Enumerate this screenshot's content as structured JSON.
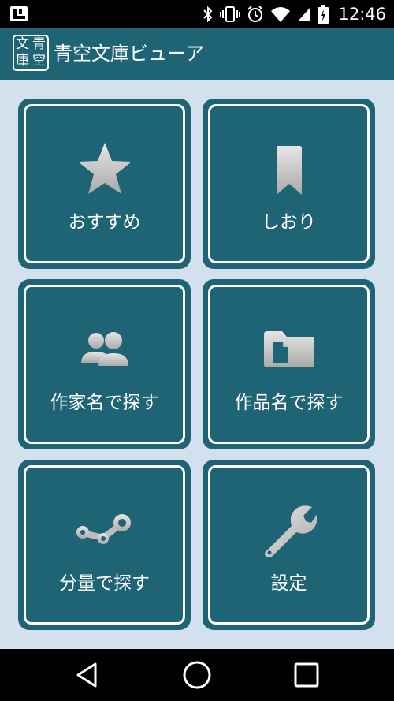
{
  "status_bar": {
    "time": "12:46",
    "icons": [
      "launcher-icon",
      "bluetooth-icon",
      "vibrate-icon",
      "alarm-icon",
      "wifi-icon",
      "signal-icon",
      "battery-icon"
    ]
  },
  "app_bar": {
    "logo_chars": [
      "文",
      "青",
      "庫",
      "空"
    ],
    "title": "青空文庫ビューア",
    "color": "#1f6474"
  },
  "menu": {
    "tiles": [
      {
        "label": "おすすめ",
        "icon": "star-icon"
      },
      {
        "label": "しおり",
        "icon": "bookmark-icon"
      },
      {
        "label": "作家名で探す",
        "icon": "people-icon"
      },
      {
        "label": "作品名で探す",
        "icon": "folder-icon"
      },
      {
        "label": "分量で探す",
        "icon": "connection-icon"
      },
      {
        "label": "設定",
        "icon": "wrench-icon"
      }
    ]
  },
  "nav_bar": {
    "buttons": [
      "back-icon",
      "home-icon",
      "recents-icon"
    ]
  },
  "colors": {
    "background": "#d3e1ee",
    "tile": "#1f6474",
    "icon": "#c8c8c8"
  }
}
